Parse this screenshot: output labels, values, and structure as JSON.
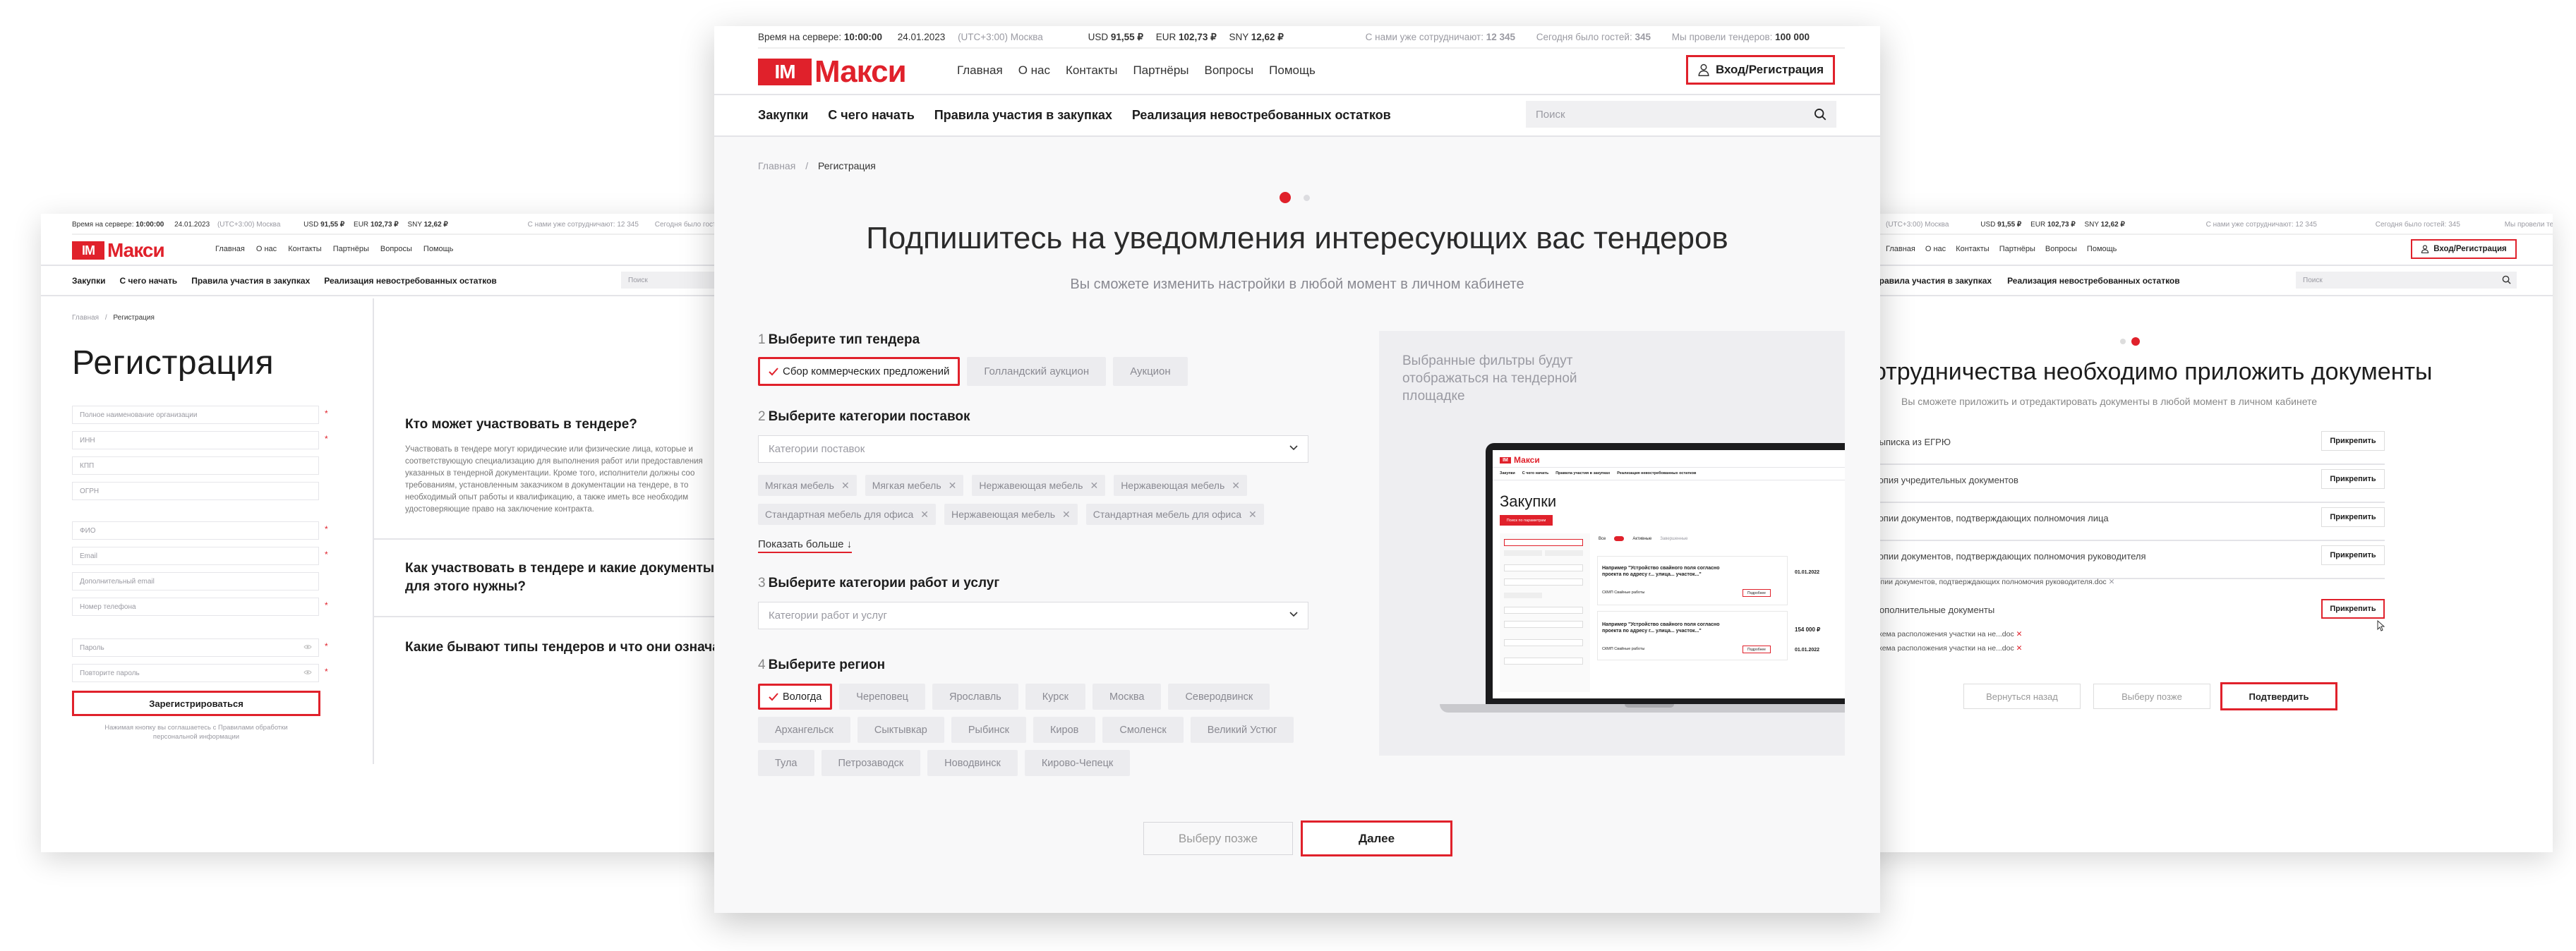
{
  "topbar": {
    "server_time_label": "Время на сервере:",
    "server_time": "10:00:00",
    "date": "24.01.2023",
    "timezone": "(UTC+3:00) Москва",
    "usd_label": "USD",
    "usd": "91,55 ₽",
    "eur_label": "EUR",
    "eur": "102,73 ₽",
    "sny_label": "SNY",
    "sny": "12,62 ₽",
    "partners_label": "С нами уже сотрудничают:",
    "partners": "12 345",
    "guests_label": "Сегодня было гостей:",
    "guests": "345",
    "tenders_label": "Мы провели тендеров:",
    "tenders": "100 000"
  },
  "logo": {
    "mark": "IM",
    "text": "Макси"
  },
  "nav": [
    "Главная",
    "О нас",
    "Контакты",
    "Партнёры",
    "Вопросы",
    "Помощь"
  ],
  "login_button": "Вход/Регистрация",
  "subnav": [
    "Закупки",
    "С чего начать",
    "Правила участия в закупках",
    "Реализация невостребованных остатков"
  ],
  "search_placeholder": "Поиск",
  "main": {
    "breadcrumb": [
      "Главная",
      "/",
      "Регистрация"
    ],
    "title": "Подпишитесь на уведомления интересующих вас тендеров",
    "subtitle": "Вы сможете изменить настройки в любой момент в личном кабинете",
    "step1": {
      "num": "1",
      "title": "Выберите тип тендера",
      "options": [
        "Сбор коммерческих предложений",
        "Голландский аукцион",
        "Аукцион"
      ]
    },
    "step2": {
      "num": "2",
      "title": "Выберите категории поставок",
      "placeholder": "Категории поставок",
      "chips": [
        "Мягкая мебель",
        "Мягкая мебель",
        "Нержавеющая мебель",
        "Нержавеющая мебель",
        "Стандартная мебель для офиса",
        "Нержавеющая мебель",
        "Стандартная мебель для офиса"
      ],
      "show_more": "Показать больше ↓"
    },
    "step3": {
      "num": "3",
      "title": "Выберите категории работ и услуг",
      "placeholder": "Категории работ и услуг"
    },
    "step4": {
      "num": "4",
      "title": "Выберите регион",
      "regions": [
        "Вологда",
        "Череповец",
        "Ярославль",
        "Курск",
        "Москва",
        "Северодвинск",
        "Архангельск",
        "Сыктывкар",
        "Рыбинск",
        "Киров",
        "Смоленск",
        "Великий Устюг",
        "Тула",
        "Петрозаводск",
        "Новодвинск",
        "Кирово-Чепецк"
      ]
    },
    "preview_caption": "Выбранные фильтры будут отображаться на тендерной площадке",
    "laptop": {
      "title": "Закупки",
      "search_btn": "Поиск по параметрам",
      "card_title": "Например \"Устройство свайного поля согласно проекта по адресу г... улица... участок...\"",
      "card_meta": "СКМП Свайные работы",
      "card_btn": "Подробнее",
      "card_date": "01.01.2022",
      "card_price": "154 000 ₽",
      "filter_options": [
        "Все",
        "Активные",
        "Завершенные"
      ]
    },
    "later_button": "Выберу позже",
    "next_button": "Далее"
  },
  "left": {
    "title": "Регистрация",
    "fields": [
      "Полное наименование организации",
      "ИНН",
      "КПП",
      "ОГРН",
      "ФИО",
      "Email",
      "Дополнительный email",
      "Номер телефона",
      "Пароль",
      "Повторите пароль"
    ],
    "required_mark": "*",
    "register_button": "Зарегистрироваться",
    "consent": "Нажимая кнопку вы соглашаетесь с Правилами обработки персональной информации",
    "faq": [
      {
        "q": "Кто может участвовать в тендере?",
        "a": "Участвовать в тендере могут юридические или физические лица, которые и соответствующую специализацию для выполнения работ или предоставления указанных в тендерной документации. Кроме того, исполнители должны соо требованиям, установленным заказчиком в документации на тендере, в то необходимый опыт работы и квалификацию, а также иметь все необходим удостоверяющие право на заключение контракта."
      },
      {
        "q": "Как участвовать в тендере и какие документы для этого нужны?",
        "a": ""
      },
      {
        "q": "Какие бывают типы тендеров и что они означают",
        "a": ""
      }
    ]
  },
  "right": {
    "title": "отрудничества необходимо приложить документы",
    "subtitle": "Вы сможете приложить и отредактировать документы в любой момент в личном кабинете",
    "attach_label": "Прикрепить",
    "docs": [
      "Выписка из ЕГРЮ",
      "Копия учредительных документов",
      "Копии документов, подтверждающих полномочия лица",
      "Копии документов, подтверждающих полномочия руководителя",
      "Дополнительные документы"
    ],
    "file_manager": "копии документов, подтверждающих полномочия руководителя.doc",
    "extra_files": [
      "Схема расположения участки на не...doc",
      "Схема расположения участки на не...doc"
    ],
    "back_button": "Вернуться назад",
    "later_button": "Выберу позже",
    "confirm_button": "Подтвердить"
  },
  "colors": {
    "accent": "#e0212b",
    "text": "#1d1d1d",
    "muted": "#9a9aa2",
    "chip": "#ececef"
  }
}
